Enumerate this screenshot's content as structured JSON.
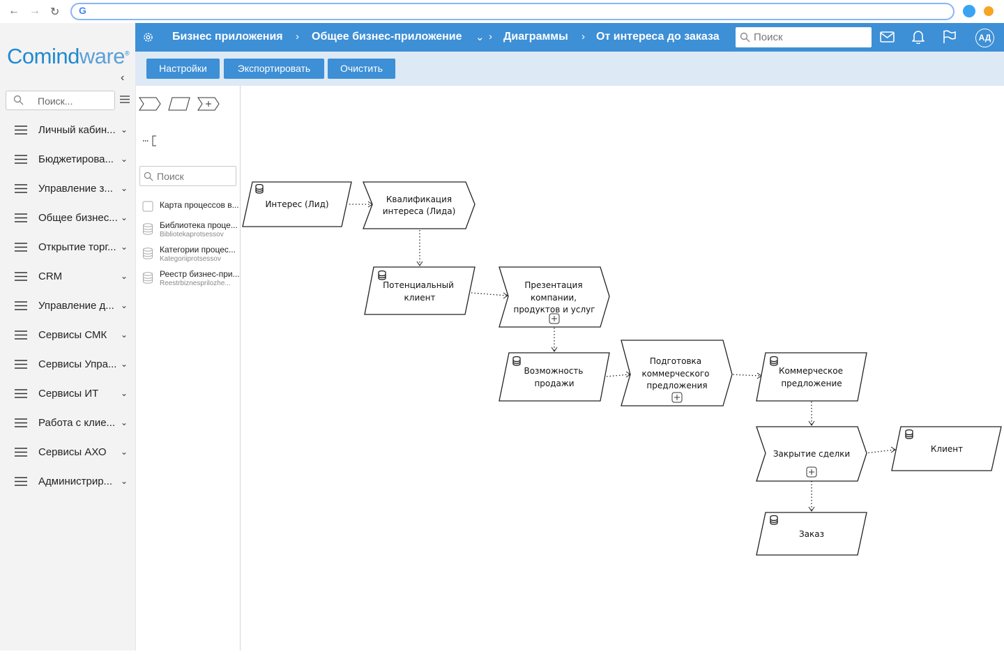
{
  "browser": {
    "google_glyph": "G"
  },
  "sidebar": {
    "logo": {
      "part1": "Comind",
      "part2": "ware",
      "mark": "®"
    },
    "search_placeholder": "Поиск...",
    "items": [
      {
        "label": "Личный кабин..."
      },
      {
        "label": "Бюджетирова..."
      },
      {
        "label": "Управление з..."
      },
      {
        "label": "Общее бизнес..."
      },
      {
        "label": "Открытие торг..."
      },
      {
        "label": "CRM"
      },
      {
        "label": "Управление д..."
      },
      {
        "label": "Сервисы СМК"
      },
      {
        "label": "Сервисы Упра..."
      },
      {
        "label": "Сервисы ИТ"
      },
      {
        "label": "Работа с клие..."
      },
      {
        "label": "Сервисы АХО"
      },
      {
        "label": "Администрир..."
      }
    ]
  },
  "header": {
    "breadcrumb": [
      "Бизнес приложения",
      "Общее бизнес-приложение",
      "Диаграммы",
      "От интереса до заказа"
    ],
    "search_placeholder": "Поиск",
    "avatar": "АД"
  },
  "toolbar": {
    "settings": "Настройки",
    "export": "Экспортировать",
    "clear": "Очистить"
  },
  "palette": {
    "search_placeholder": "Поиск",
    "items": [
      {
        "title": "Карта процессов в...",
        "subtitle": ""
      },
      {
        "title": "Библиотека проце...",
        "subtitle": "Bibliotekaprotsessov"
      },
      {
        "title": "Категории процес...",
        "subtitle": "Kategoriiprotsessov"
      },
      {
        "title": "Реестр бизнес-при...",
        "subtitle": "Reestrbiznesprilozhe..."
      }
    ]
  },
  "diagram": {
    "nodes": {
      "lead_interest": {
        "lines": [
          "Интерес (Лид)"
        ]
      },
      "lead_qualification": {
        "lines": [
          "Квалификация",
          "интереса (Лида)"
        ]
      },
      "potential_client": {
        "lines": [
          "Потенциальный",
          "клиент"
        ]
      },
      "presentation": {
        "lines": [
          "Презентация",
          "компании,",
          "продуктов и услуг"
        ]
      },
      "sale_opportunity": {
        "lines": [
          "Возможность",
          "продажи"
        ]
      },
      "proposal_prep": {
        "lines": [
          "Подготовка",
          "коммерческого",
          "предложения"
        ]
      },
      "commercial_offer": {
        "lines": [
          "Коммерческое",
          "предложение"
        ]
      },
      "deal_closing": {
        "lines": [
          "Закрытие сделки"
        ]
      },
      "client": {
        "lines": [
          "Клиент"
        ]
      },
      "order": {
        "lines": [
          "Заказ"
        ]
      }
    }
  }
}
